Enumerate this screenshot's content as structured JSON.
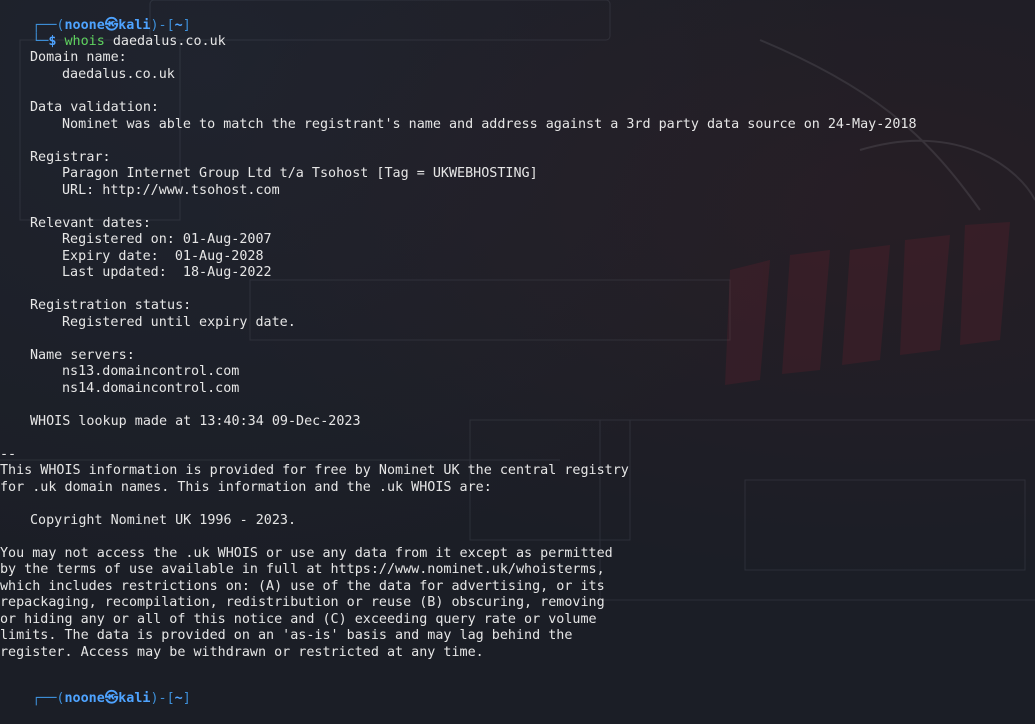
{
  "prompt": {
    "user": "noone",
    "at": "㉿",
    "host": "kali",
    "cwd": "~",
    "box_top": "┌──(",
    "box_bottom": "└─",
    "dollar": "$"
  },
  "command": {
    "name": "whois",
    "arg": "daedalus.co.uk"
  },
  "output": {
    "domain_name_label": "Domain name:",
    "domain_name": "daedalus.co.uk",
    "data_validation_label": "Data validation:",
    "data_validation": "Nominet was able to match the registrant's name and address against a 3rd party data source on 24-May-2018",
    "registrar_label": "Registrar:",
    "registrar_name": "Paragon Internet Group Ltd t/a Tsohost [Tag = UKWEBHOSTING]",
    "registrar_url": "URL: http://www.tsohost.com",
    "relevant_dates_label": "Relevant dates:",
    "registered_on": "Registered on: 01-Aug-2007",
    "expiry_date": "Expiry date:  01-Aug-2028",
    "last_updated": "Last updated:  18-Aug-2022",
    "registration_status_label": "Registration status:",
    "registration_status": "Registered until expiry date.",
    "name_servers_label": "Name servers:",
    "name_servers": [
      "ns13.domaincontrol.com",
      "ns14.domaincontrol.com"
    ],
    "lookup_made": "WHOIS lookup made at 13:40:34 09-Dec-2023",
    "separator": "--",
    "info_lines": [
      "This WHOIS information is provided for free by Nominet UK the central registry",
      "for .uk domain names. This information and the .uk WHOIS are:"
    ],
    "copyright": "Copyright Nominet UK 1996 - 2023.",
    "terms_lines": [
      "You may not access the .uk WHOIS or use any data from it except as permitted",
      "by the terms of use available in full at https://www.nominet.uk/whoisterms,",
      "which includes restrictions on: (A) use of the data for advertising, or its",
      "repackaging, recompilation, redistribution or reuse (B) obscuring, removing",
      "or hiding any or all of this notice and (C) exceeding query rate or volume",
      "limits. The data is provided on an 'as-is' basis and may lag behind the",
      "register. Access may be withdrawn or restricted at any time."
    ]
  },
  "colors": {
    "background": "#1b1e26",
    "prompt_blue": "#3d8fd8",
    "command_green": "#5fd35f",
    "text": "#e6e6e6"
  }
}
